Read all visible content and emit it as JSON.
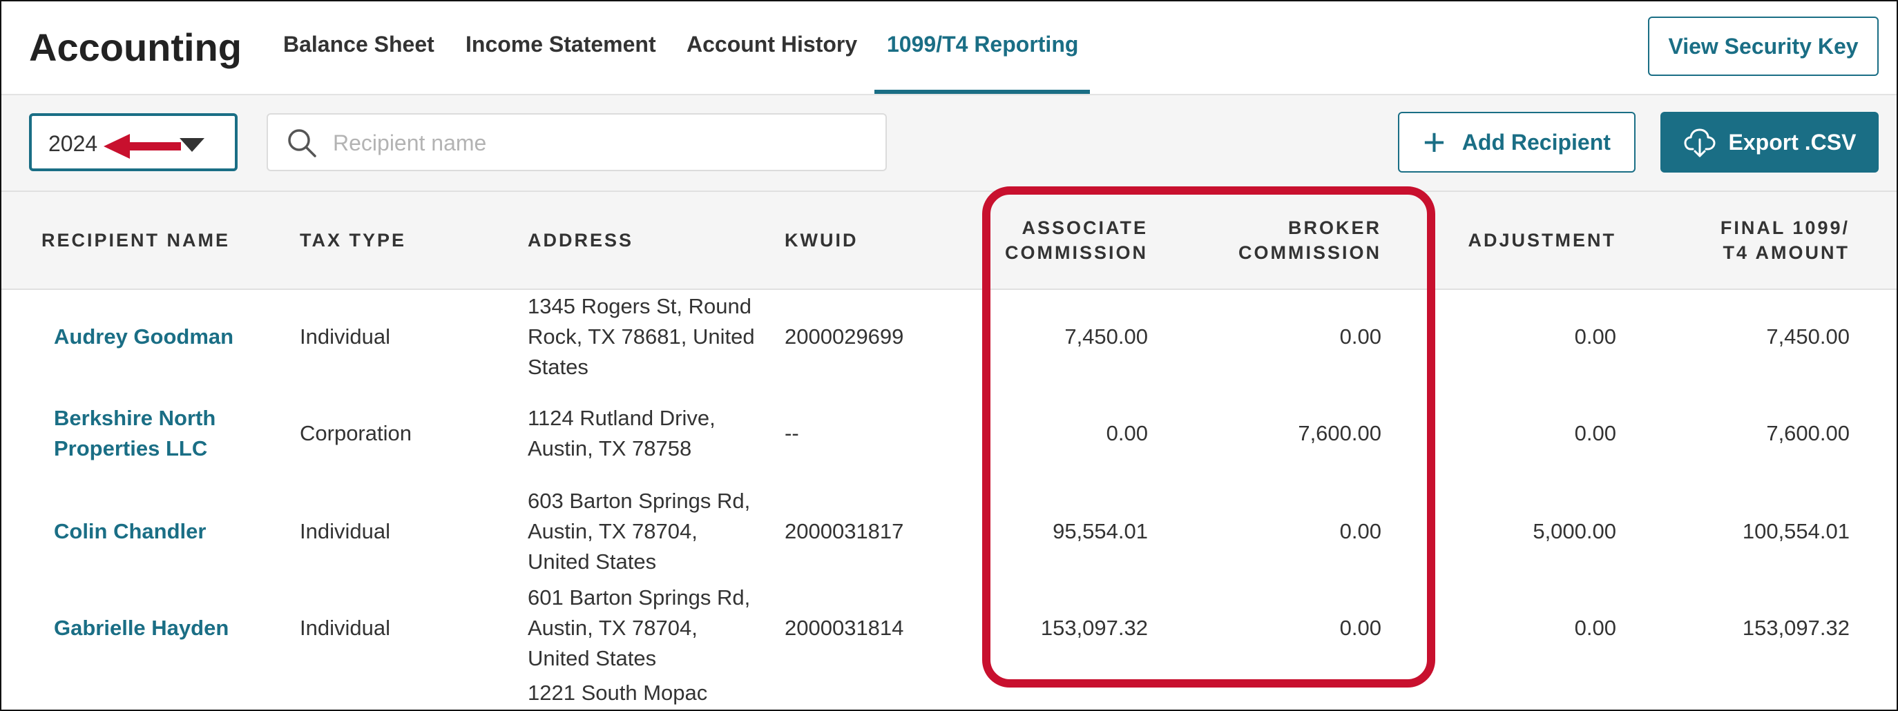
{
  "app_title": "Accounting",
  "tabs": [
    {
      "label": "Balance Sheet"
    },
    {
      "label": "Income Statement"
    },
    {
      "label": "Account History"
    },
    {
      "label": "1099/T4 Reporting"
    }
  ],
  "header": {
    "security_label": "View Security Key"
  },
  "toolbar": {
    "year": "2024",
    "search_placeholder": "Recipient name",
    "add_label": "Add Recipient",
    "export_label": "Export .CSV"
  },
  "table": {
    "columns": [
      {
        "label": "RECIPIENT NAME"
      },
      {
        "label": "TAX TYPE"
      },
      {
        "label": "ADDRESS"
      },
      {
        "label": "KWUID"
      },
      {
        "line1": "ASSOCIATE",
        "line2": "COMMISSION"
      },
      {
        "line1": "BROKER",
        "line2": "COMMISSION"
      },
      {
        "label": "ADJUSTMENT"
      },
      {
        "line1": "FINAL 1099/",
        "line2": "T4 AMOUNT"
      }
    ],
    "rows": [
      {
        "name": [
          "Audrey Goodman"
        ],
        "tax_type": "Individual",
        "address": [
          "1345 Rogers St, Round",
          "Rock, TX 78681, United",
          "States"
        ],
        "kwuid": "2000029699",
        "associate": "7,450.00",
        "broker": "0.00",
        "adjustment": "0.00",
        "final": "7,450.00"
      },
      {
        "name": [
          "Berkshire North",
          "Properties LLC"
        ],
        "tax_type": "Corporation",
        "address": [
          "1124 Rutland Drive,",
          "Austin, TX 78758"
        ],
        "kwuid": "--",
        "associate": "0.00",
        "broker": "7,600.00",
        "adjustment": "0.00",
        "final": "7,600.00"
      },
      {
        "name": [
          "Colin Chandler"
        ],
        "tax_type": "Individual",
        "address": [
          "603 Barton Springs Rd,",
          "Austin, TX 78704,",
          "United States"
        ],
        "kwuid": "2000031817",
        "associate": "95,554.01",
        "broker": "0.00",
        "adjustment": "5,000.00",
        "final": "100,554.01"
      },
      {
        "name": [
          "Gabrielle Hayden"
        ],
        "tax_type": "Individual",
        "address": [
          "601 Barton Springs Rd,",
          "Austin, TX 78704,",
          "United States"
        ],
        "kwuid": "2000031814",
        "associate": "153,097.32",
        "broker": "0.00",
        "adjustment": "0.00",
        "final": "153,097.32"
      },
      {
        "address": [
          "1221 South Mopac"
        ]
      }
    ]
  },
  "colors": {
    "accent": "#1a6e85",
    "highlight": "#c8102e",
    "arrow": "#c8102e"
  }
}
